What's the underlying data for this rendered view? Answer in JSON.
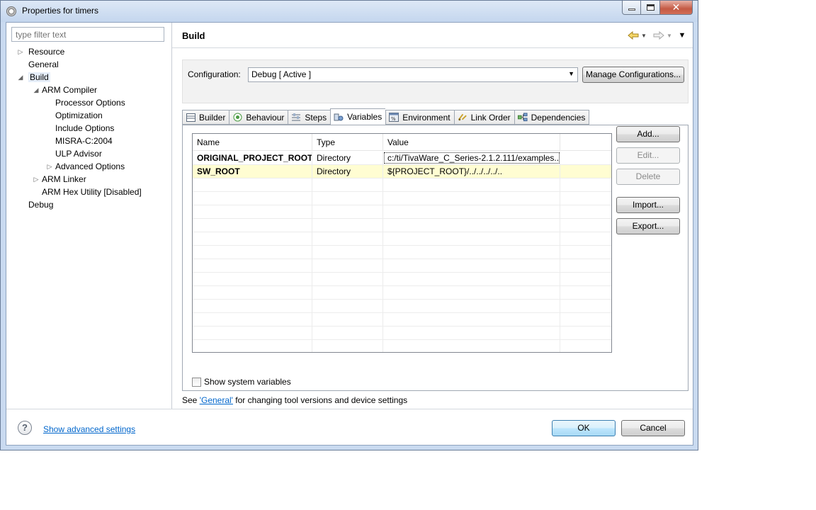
{
  "window": {
    "title": "Properties for timers",
    "minimize_icon": "minimize-icon",
    "maximize_icon": "maximize-icon",
    "close_icon": "close-icon"
  },
  "filter": {
    "placeholder": "type filter text"
  },
  "tree": [
    {
      "label": "Resource",
      "depth": 0,
      "toggle": "collapsed"
    },
    {
      "label": "General",
      "depth": 0,
      "toggle": "none"
    },
    {
      "label": "Build",
      "depth": 0,
      "toggle": "expanded",
      "selected": true
    },
    {
      "label": "ARM Compiler",
      "depth": 1,
      "toggle": "expanded"
    },
    {
      "label": "Processor Options",
      "depth": 2,
      "toggle": "none"
    },
    {
      "label": "Optimization",
      "depth": 2,
      "toggle": "none"
    },
    {
      "label": "Include Options",
      "depth": 2,
      "toggle": "none"
    },
    {
      "label": "MISRA-C:2004",
      "depth": 2,
      "toggle": "none"
    },
    {
      "label": "ULP Advisor",
      "depth": 2,
      "toggle": "none"
    },
    {
      "label": "Advanced Options",
      "depth": 2,
      "toggle": "collapsed"
    },
    {
      "label": "ARM Linker",
      "depth": 1,
      "toggle": "collapsed"
    },
    {
      "label": "ARM Hex Utility  [Disabled]",
      "depth": 1,
      "toggle": "none"
    },
    {
      "label": "Debug",
      "depth": 0,
      "toggle": "none"
    }
  ],
  "page": {
    "title": "Build"
  },
  "configuration": {
    "label": "Configuration:",
    "value": "Debug  [ Active ]",
    "manage_button": "Manage Configurations..."
  },
  "tabs": [
    {
      "label": "Builder",
      "icon": "builder-icon",
      "active": false
    },
    {
      "label": "Behaviour",
      "icon": "behaviour-icon",
      "active": false
    },
    {
      "label": "Steps",
      "icon": "steps-icon",
      "active": false
    },
    {
      "label": "Variables",
      "icon": "variables-icon",
      "active": true
    },
    {
      "label": "Environment",
      "icon": "environment-icon",
      "active": false
    },
    {
      "label": "Link Order",
      "icon": "link-order-icon",
      "active": false
    },
    {
      "label": "Dependencies",
      "icon": "dependencies-icon",
      "active": false
    }
  ],
  "variables_table": {
    "columns": [
      "Name",
      "Type",
      "Value"
    ],
    "rows": [
      {
        "name": "ORIGINAL_PROJECT_ROOT",
        "type": "Directory",
        "value": "c:/ti/TivaWare_C_Series-2.1.2.111/examples..."
      },
      {
        "name": "SW_ROOT",
        "type": "Directory",
        "value": "${PROJECT_ROOT}/../../../../.."
      }
    ],
    "empty_rows": 13
  },
  "side_buttons": {
    "add": "Add...",
    "edit": "Edit...",
    "delete": "Delete",
    "import": "Import...",
    "export": "Export..."
  },
  "show_system_variables": {
    "label": "Show system variables",
    "checked": false
  },
  "general_note": {
    "prefix": "See ",
    "link": "'General'",
    "suffix": " for changing tool versions and device settings"
  },
  "footer": {
    "advanced_link": "Show advanced settings",
    "ok": "OK",
    "cancel": "Cancel"
  }
}
